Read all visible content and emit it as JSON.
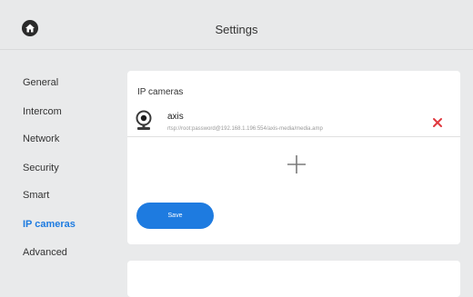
{
  "header": {
    "title": "Settings",
    "home_icon": "home-icon"
  },
  "sidebar": {
    "items": [
      {
        "label": "General"
      },
      {
        "label": "Intercom"
      },
      {
        "label": "Network"
      },
      {
        "label": "Security"
      },
      {
        "label": "Smart"
      },
      {
        "label": "IP cameras",
        "active": true
      },
      {
        "label": "Advanced"
      }
    ]
  },
  "main": {
    "section_title": "IP cameras",
    "cameras": [
      {
        "name": "axis",
        "url": "rtsp://root:password@192.168.1.196:554/axis-media/media.amp",
        "icon": "camera-icon"
      }
    ],
    "add_icon": "plus-icon",
    "delete_icon": "close-icon",
    "save_label": "Save"
  },
  "colors": {
    "accent": "#1e7be0",
    "delete": "#e0383e",
    "background": "#e9eaeb",
    "card": "#ffffff"
  }
}
